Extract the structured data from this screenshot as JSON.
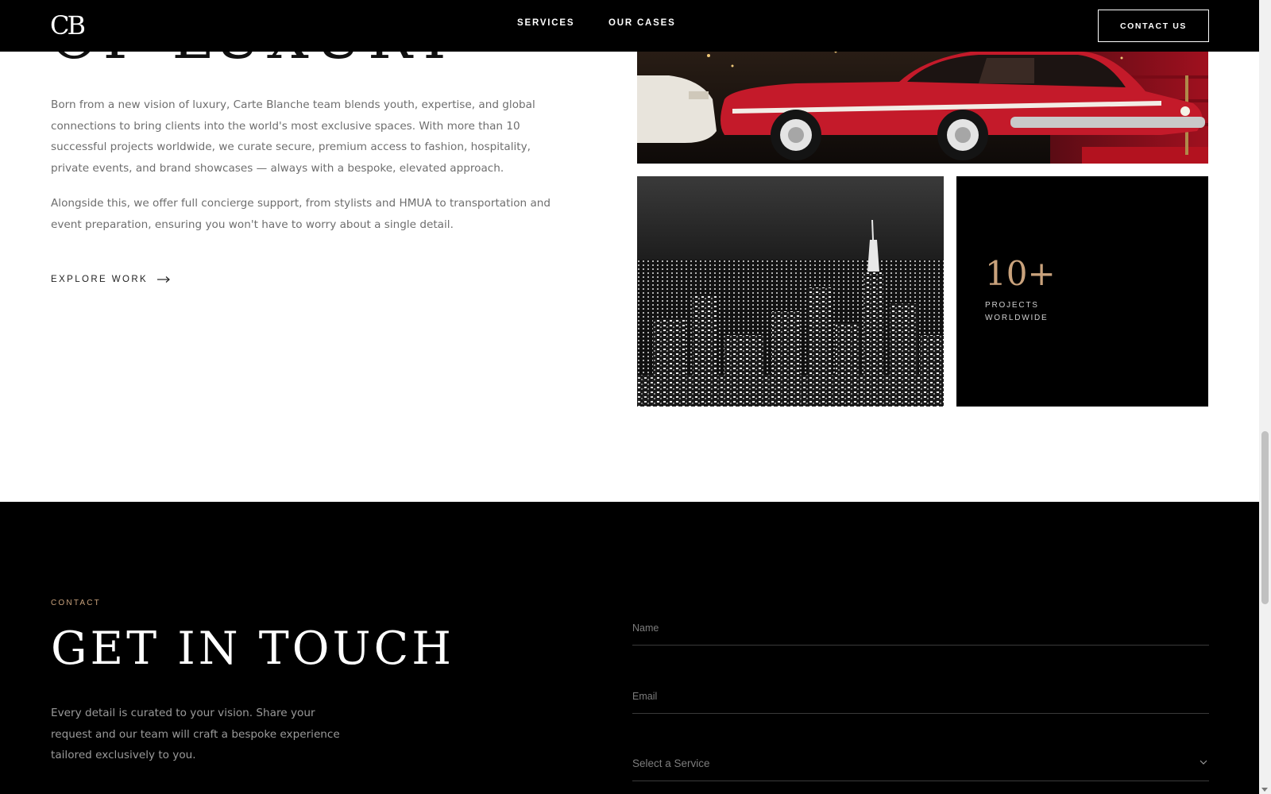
{
  "header": {
    "logo": "CB",
    "nav": {
      "services": "SERVICES",
      "cases": "OUR CASES"
    },
    "contact_button": "CONTACT US"
  },
  "about": {
    "title_peek": "OF LUXURY",
    "paragraph_1": "Born from a new vision of luxury, Carte Blanche team blends youth, expertise, and global connections to bring clients into the world's most exclusive spaces. With more than 10 successful projects worldwide, we curate secure, premium access to fashion, hospitality, private events, and brand showcases — always with a bespoke, elevated approach.",
    "paragraph_2": "Alongside this, we offer full concierge support, from stylists and HMUA to transportation and event preparation, ensuring you won't have to worry about a single detail.",
    "explore_label": "EXPLORE WORK",
    "stat": {
      "number": "10+",
      "label": "PROJECTS WORLDWIDE"
    }
  },
  "contact": {
    "eyebrow": "CONTACT",
    "title": "GET IN TOUCH",
    "description": "Every detail is curated to your vision. Share your request and our team will craft a bespoke experience tailored exclusively to you.",
    "form": {
      "name_placeholder": "Name",
      "email_placeholder": "Email",
      "service_placeholder": "Select a Service"
    }
  },
  "colors": {
    "accent_gold": "#c9a27c",
    "background_dark": "#000000",
    "car_red": "#c41a2a"
  },
  "icons": [
    "arrow-right-icon",
    "chevron-down-icon"
  ]
}
